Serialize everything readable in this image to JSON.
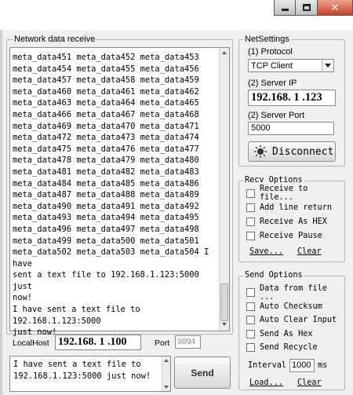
{
  "receive": {
    "legend": "Network data receive",
    "lines": [
      "meta_data451 meta_data452 meta_data453",
      "meta_data454 meta_data455 meta_data456",
      "meta_data457 meta_data458 meta_data459",
      "meta_data460 meta_data461 meta_data462",
      "meta_data463 meta_data464 meta_data465",
      "meta_data466 meta_data467 meta_data468",
      "meta_data469 meta_data470 meta_data471",
      "meta_data472 meta_data473 meta_data474",
      "meta_data475 meta_data476 meta_data477",
      "meta_data478 meta_data479 meta_data480",
      "meta_data481 meta_data482 meta_data483",
      "meta_data484 meta_data485 meta_data486",
      "meta_data487 meta_data488 meta_data489",
      "meta_data490 meta_data491 meta_data492",
      "meta_data493 meta_data494 meta_data495",
      "meta_data496 meta_data497 meta_data498",
      "meta_data499 meta_data500 meta_data501",
      "meta_data502 meta_data503 meta_data504 I have",
      "sent a text file to 192.168.1.123:5000 just",
      "now!",
      "I have sent a text file to 192.168.1.123:5000",
      "just now!"
    ]
  },
  "local": {
    "label": "LocalHost",
    "ip": "192.168. 1 .100",
    "port_label": "Port",
    "port": "9894"
  },
  "send": {
    "text": "I have sent a text file to\n192.168.1.123:5000 just now!",
    "button": "Send"
  },
  "net_settings": {
    "legend": "NetSettings",
    "protocol_label": "(1) Protocol",
    "protocol_value": "TCP Client",
    "server_ip_label": "(2) Server IP",
    "server_ip": "192.168. 1 .123",
    "server_port_label": "(2) Server Port",
    "server_port": "5000",
    "disconnect_label": "Disconnect"
  },
  "recv_options": {
    "legend": "Recv Options",
    "items": [
      "Receive to file...",
      "Add line return",
      "Receive As HEX",
      "Receive Pause"
    ],
    "save_label": "Save...",
    "clear_label": "Clear"
  },
  "send_options": {
    "legend": "Send Options",
    "items": [
      "Data from file ...",
      "Auto Checksum",
      "Auto Clear Input",
      "Send As Hex",
      "Send Recycle"
    ],
    "interval_label": "Interval",
    "interval_value": "1000",
    "interval_unit": "ms",
    "load_label": "Load...",
    "clear_label": "Clear"
  },
  "colors": {
    "window_bg": "#f0f0f0",
    "close_button": "#c8402a"
  }
}
